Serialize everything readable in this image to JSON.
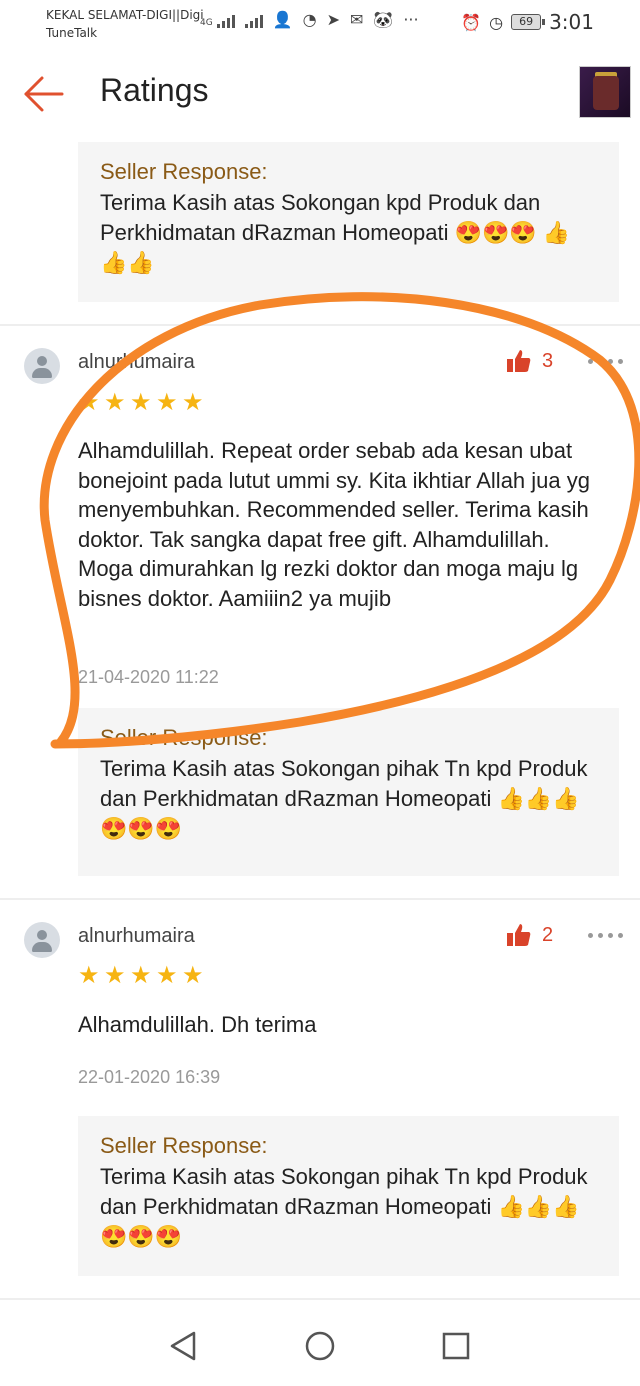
{
  "status_bar": {
    "carrier_line1": "KEKAL SELAMAT-DIGI||Digi",
    "carrier_line2": "TuneTalk",
    "network_type": "4G",
    "more_glyph": "···",
    "battery": "69",
    "time": "3:01"
  },
  "header": {
    "title": "Ratings"
  },
  "reviews": [
    {
      "seller_response_label": "Seller Response:",
      "seller_response_text": "Terima Kasih atas Sokongan kpd Produk dan Perkhidmatan dRazman Homeopati 😍😍😍 👍👍👍"
    },
    {
      "username": "alnurhumaira",
      "likes": "3",
      "rating": 5,
      "text": "Alhamdulillah. Repeat order sebab ada kesan ubat bonejoint pada lutut ummi sy. Kita ikhtiar Allah jua yg menyembuhkan. Recommended seller. Terima kasih doktor. Tak sangka dapat free gift. Alhamdulillah. Moga dimurahkan lg rezki doktor dan moga maju lg bisnes doktor. Aamiiin2 ya mujib",
      "date": "21-04-2020 11:22",
      "seller_response_label": "Seller Response:",
      "seller_response_text": "Terima Kasih atas Sokongan pihak Tn kpd Produk dan Perkhidmatan dRazman Homeopati 👍👍👍😍😍😍"
    },
    {
      "username": "alnurhumaira",
      "likes": "2",
      "rating": 5,
      "text": "Alhamdulillah. Dh terima",
      "date": "22-01-2020 16:39",
      "seller_response_label": "Seller Response:",
      "seller_response_text": "Terima Kasih atas Sokongan pihak Tn kpd Produk dan Perkhidmatan dRazman Homeopati 👍👍👍😍😍😍"
    }
  ],
  "colors": {
    "accent": "#d9432a",
    "star": "#f6b412",
    "seller_label": "#8a5a16",
    "annotation": "#f5862a"
  },
  "icons": {
    "back": "back-arrow-icon",
    "like": "thumbs-up-icon",
    "more": "more-dots-icon",
    "nav_back": "triangle-back-icon",
    "nav_home": "circle-home-icon",
    "nav_recent": "square-recents-icon"
  }
}
